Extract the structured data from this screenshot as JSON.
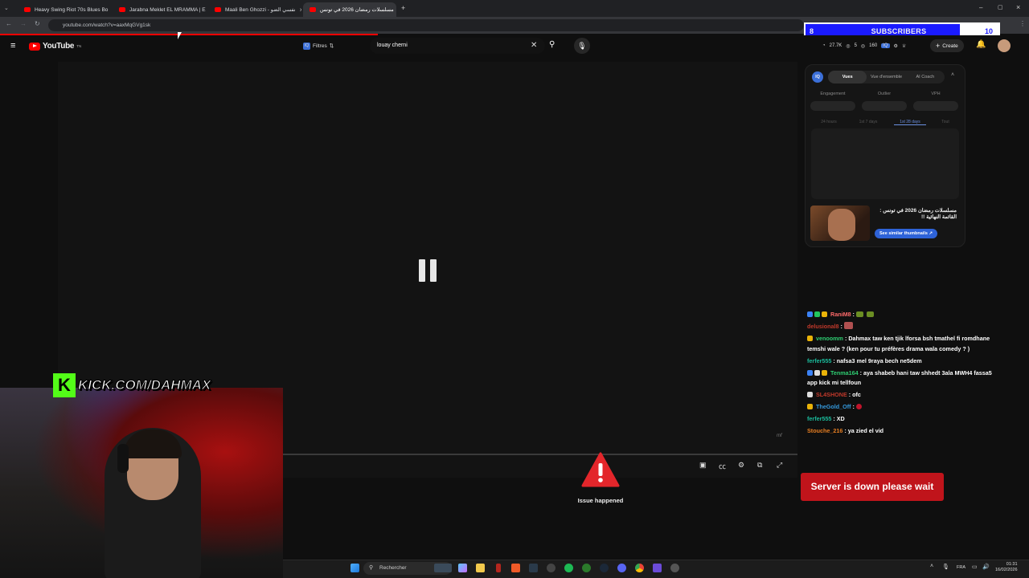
{
  "browser": {
    "tabs": [
      {
        "title": "Heavy Swing Riot 70s Blues Bo"
      },
      {
        "title": "Jarabna Meklet EL MRAMMA | E"
      },
      {
        "title": "Maali Ben Ghozzi - نفسي الضو"
      },
      {
        "title": "مسلسلات رمضان 2026 في تونس"
      }
    ],
    "url": "youtube.com/watch?v=aaxMqGVg1sk"
  },
  "overlay": {
    "subscribers_left": "8",
    "subscribers_label": "SUBSCRIBERS",
    "subscribers_right": "10",
    "kick_url": "KICK.COM/DAHMAX",
    "kick_logo": "K"
  },
  "youtube": {
    "logo_text": "YouTube",
    "logo_sup": "TN",
    "filters_label": "Filtres",
    "search_value": "louay cherni",
    "stats": [
      "27.7K",
      "5",
      "160"
    ],
    "create_label": "Create"
  },
  "player": {
    "issue_text": "Issue happened"
  },
  "extension": {
    "iq_badge": "IQ",
    "tabs": [
      "Vues",
      "Vue d'ensemble",
      "AI Coach"
    ],
    "metrics": [
      "Engagement",
      "Outlier",
      "VPH"
    ],
    "ranges": [
      "24 hours",
      "1st 7 days",
      "1st 28 days",
      "Tout"
    ],
    "video_title": "مسلسلات رمضان 2026 في تونس : القائمة النهائية !!",
    "similar_button": "See similar thumbnails"
  },
  "chat": [
    {
      "user": "RaniM8",
      "text": "",
      "color": "#ff6b6b"
    },
    {
      "user": "delusional8",
      "text": "",
      "color": "#c0392b"
    },
    {
      "user": "venoomm",
      "text": "Dahmax taw ken tjik lforsa bsh tmathel fi romdhane temshi wale ? (ken pour tu préfères drama wala comedy ? )",
      "color": "#2ecc71"
    },
    {
      "user": "ferfer555",
      "text": "nafsa3 mel 9raya bech ne5dem",
      "color": "#1abc9c"
    },
    {
      "user": "Tenma164",
      "text": "aya shabeb hani taw shhedt 3ala MWH4 fassa5 app kick mi tellfoun",
      "color": "#2ecc71"
    },
    {
      "user": "SL4SHONE",
      "text": "ofc",
      "color": "#c0392b"
    },
    {
      "user": "TheGold_Off",
      "text": "",
      "color": "#3498db"
    },
    {
      "user": "ferfer555",
      "text": "XD",
      "color": "#1abc9c"
    },
    {
      "user": "Stouche_216",
      "text": "ya zied el vid",
      "color": "#e67e22"
    }
  ],
  "alert": {
    "server_down": "Server is down please wait"
  },
  "taskbar": {
    "search_label": "Rechercher",
    "lang": "FRA",
    "time": "01:31",
    "date": "16/02/2026"
  }
}
